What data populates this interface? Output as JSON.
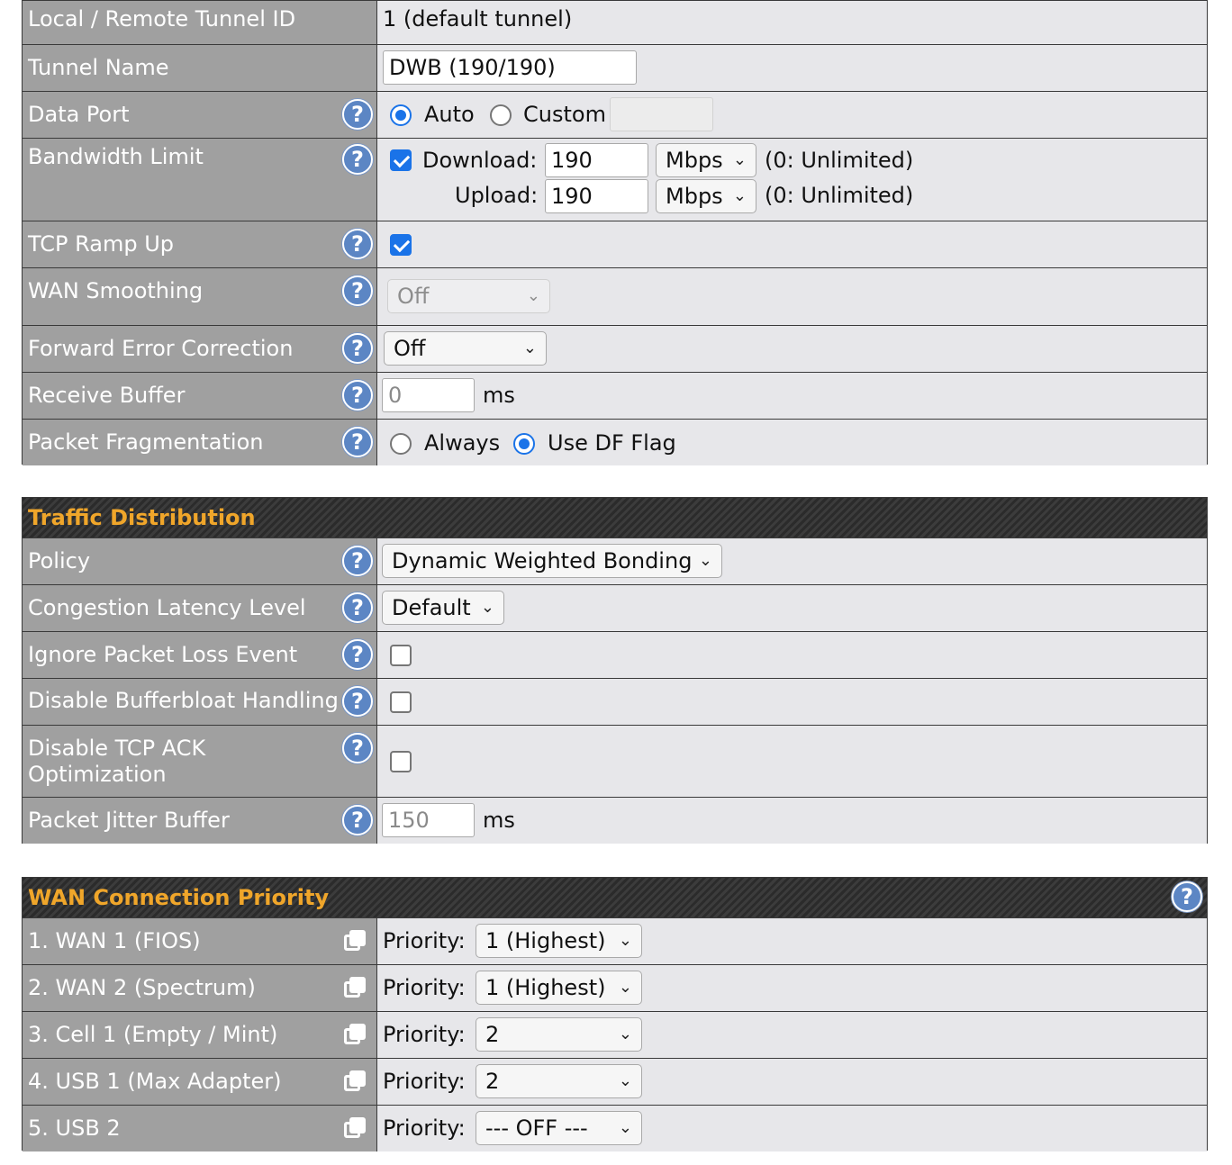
{
  "tunnel": {
    "tunnel_id": {
      "label": "Local / Remote Tunnel ID",
      "value": "1 (default tunnel)"
    },
    "tunnel_name": {
      "label": "Tunnel Name",
      "value": "DWB (190/190)"
    },
    "data_port": {
      "label": "Data Port",
      "auto_label": "Auto",
      "custom_label": "Custom",
      "selected": "Auto",
      "custom_value": ""
    },
    "bandwidth_limit": {
      "label": "Bandwidth Limit",
      "enabled": true,
      "download_label": "Download:",
      "download_value": "190",
      "download_unit": "Mbps",
      "download_hint": "(0: Unlimited)",
      "upload_label": "Upload:",
      "upload_value": "190",
      "upload_unit": "Mbps",
      "upload_hint": "(0: Unlimited)"
    },
    "tcp_ramp_up": {
      "label": "TCP Ramp Up",
      "checked": true
    },
    "wan_smoothing": {
      "label": "WAN Smoothing",
      "value": "Off"
    },
    "fec": {
      "label": "Forward Error Correction",
      "value": "Off"
    },
    "receive_buffer": {
      "label": "Receive Buffer",
      "placeholder": "0",
      "unit": "ms"
    },
    "packet_fragmentation": {
      "label": "Packet Fragmentation",
      "always_label": "Always",
      "df_label": "Use DF Flag",
      "selected": "Use DF Flag"
    }
  },
  "traffic": {
    "title": "Traffic Distribution",
    "policy": {
      "label": "Policy",
      "value": "Dynamic Weighted Bonding"
    },
    "congestion": {
      "label": "Congestion Latency Level",
      "value": "Default"
    },
    "ignore_loss": {
      "label": "Ignore Packet Loss Event",
      "checked": false
    },
    "disable_bufferbloat": {
      "label": "Disable Bufferbloat Handling",
      "checked": false
    },
    "disable_tcp_ack": {
      "label_line1": "Disable TCP ACK",
      "label_line2": "Optimization",
      "checked": false
    },
    "jitter_buffer": {
      "label": "Packet Jitter Buffer",
      "placeholder": "150",
      "unit": "ms"
    }
  },
  "wan_priority": {
    "title": "WAN Connection Priority",
    "priority_label": "Priority:",
    "rows": [
      {
        "name": "1. WAN 1 (FIOS)",
        "priority": "1 (Highest)"
      },
      {
        "name": "2. WAN 2 (Spectrum)",
        "priority": "1 (Highest)"
      },
      {
        "name": "3. Cell 1 (Empty / Mint)",
        "priority": "2"
      },
      {
        "name": "4. USB 1 (Max Adapter)",
        "priority": "2"
      },
      {
        "name": "5. USB 2",
        "priority": "--- OFF ---"
      }
    ]
  },
  "icons": {
    "help": "?",
    "chevron": "⌄"
  }
}
